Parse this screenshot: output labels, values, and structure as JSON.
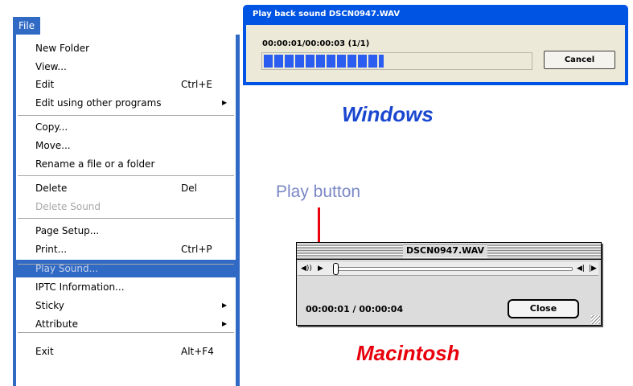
{
  "menu": {
    "title": "File",
    "items": [
      {
        "label": "New Folder",
        "shortcut": "",
        "submenu": false,
        "disabled": false,
        "highlighted": false
      },
      {
        "label": "View...",
        "shortcut": "",
        "submenu": false,
        "disabled": false,
        "highlighted": false
      },
      {
        "label": "Edit",
        "shortcut": "Ctrl+E",
        "submenu": false,
        "disabled": false,
        "highlighted": false
      },
      {
        "label": "Edit using other programs",
        "shortcut": "",
        "submenu": true,
        "disabled": false,
        "highlighted": false
      },
      {
        "label": "Copy...",
        "shortcut": "",
        "submenu": false,
        "disabled": false,
        "highlighted": false
      },
      {
        "label": "Move...",
        "shortcut": "",
        "submenu": false,
        "disabled": false,
        "highlighted": false
      },
      {
        "label": "Rename a file or a folder",
        "shortcut": "",
        "submenu": false,
        "disabled": false,
        "highlighted": false
      },
      {
        "label": "Delete",
        "shortcut": "Del",
        "submenu": false,
        "disabled": false,
        "highlighted": false
      },
      {
        "label": "Delete Sound",
        "shortcut": "",
        "submenu": false,
        "disabled": true,
        "highlighted": false
      },
      {
        "label": "Page Setup...",
        "shortcut": "",
        "submenu": false,
        "disabled": false,
        "highlighted": false
      },
      {
        "label": "Print...",
        "shortcut": "Ctrl+P",
        "submenu": false,
        "disabled": false,
        "highlighted": false
      },
      {
        "label": "Play Sound...",
        "shortcut": "",
        "submenu": false,
        "disabled": true,
        "highlighted": true
      },
      {
        "label": "IPTC Information...",
        "shortcut": "",
        "submenu": false,
        "disabled": false,
        "highlighted": false
      },
      {
        "label": "Sticky",
        "shortcut": "",
        "submenu": true,
        "disabled": false,
        "highlighted": false
      },
      {
        "label": "Attribute",
        "shortcut": "",
        "submenu": true,
        "disabled": false,
        "highlighted": false
      },
      {
        "label": "Exit",
        "shortcut": "Alt+F4",
        "submenu": false,
        "disabled": false,
        "highlighted": false
      }
    ]
  },
  "windows_dialog": {
    "title": "Play back sound DSCN0947.WAV",
    "time": "00:00:01/00:00:03 (1/1)",
    "progress": 0.45,
    "cancel_label": "Cancel"
  },
  "windows_label": "Windows",
  "play_button_label": "Play button",
  "mac_dialog": {
    "title": "DSCN0947.WAV",
    "time": "00:00:01 / 00:00:04",
    "close_label": "Close",
    "position": 0
  },
  "mac_label": "Macintosh",
  "colors": {
    "menu_highlight": "#316ac5",
    "windows_label": "#1a47d0",
    "mac_label": "#e8000c",
    "play_label": "#7b88c5",
    "progress_fill": "#2a5df0"
  }
}
